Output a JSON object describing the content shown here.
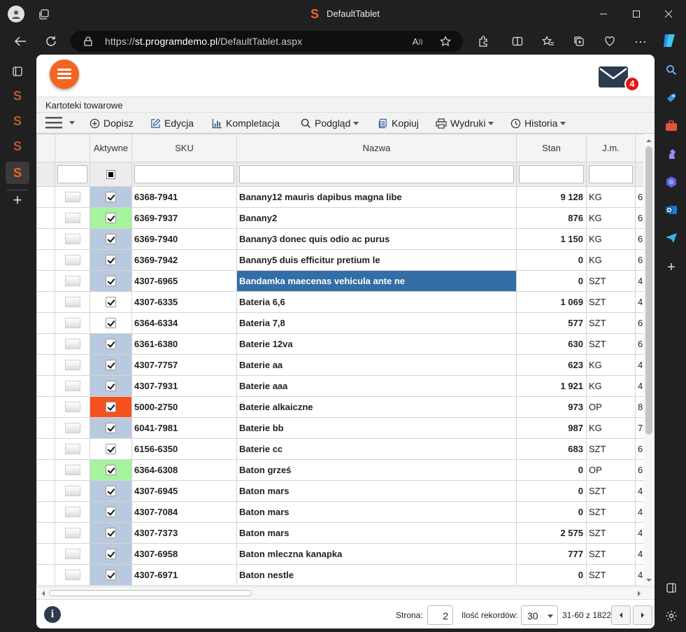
{
  "browser": {
    "title": "DefaultTablet",
    "url_scheme": "https://",
    "url_domain": "st.programdemo.pl",
    "url_path": "/DefaultTablet.aspx"
  },
  "page": {
    "breadcrumb": "Kartoteki towarowe",
    "mail_badge": "4",
    "toolbar": {
      "dopisz": "Dopisz",
      "edycja": "Edycja",
      "kompletacja": "Kompletacja",
      "podglad": "Podgląd",
      "kopiuj": "Kopiuj",
      "wydruki": "Wydruki",
      "historia": "Historia"
    },
    "columns": {
      "aktywne": "Aktywne",
      "sku": "SKU",
      "nazwa": "Nazwa",
      "stan": "Stan",
      "jm": "J.m."
    },
    "rows": [
      {
        "sku": "6368-7941",
        "name": "Banany12 mauris dapibus magna libe",
        "stan": "9 128",
        "jm": "KG",
        "x": "6",
        "status": "blue"
      },
      {
        "sku": "6369-7937",
        "name": "Banany2",
        "stan": "876",
        "jm": "KG",
        "x": "6",
        "status": "green"
      },
      {
        "sku": "6369-7940",
        "name": "Banany3 donec quis odio ac purus",
        "stan": "1 150",
        "jm": "KG",
        "x": "6",
        "status": "blue"
      },
      {
        "sku": "6369-7942",
        "name": "Banany5 duis efficitur pretium le",
        "stan": "0",
        "jm": "KG",
        "x": "6",
        "status": "blue"
      },
      {
        "sku": "4307-6965",
        "name": "Bandamka maecenas vehicula ante ne",
        "stan": "0",
        "jm": "SZT",
        "x": "4",
        "status": "blue",
        "selected": true
      },
      {
        "sku": "4307-6335",
        "name": "Bateria 6,6",
        "stan": "1 069",
        "jm": "SZT",
        "x": "4",
        "status": "none"
      },
      {
        "sku": "6364-6334",
        "name": "Bateria 7,8",
        "stan": "577",
        "jm": "SZT",
        "x": "6",
        "status": "none"
      },
      {
        "sku": "6361-6380",
        "name": "Baterie 12va",
        "stan": "630",
        "jm": "SZT",
        "x": "6",
        "status": "blue"
      },
      {
        "sku": "4307-7757",
        "name": "Baterie aa",
        "stan": "623",
        "jm": "KG",
        "x": "4",
        "status": "blue"
      },
      {
        "sku": "4307-7931",
        "name": "Baterie aaa",
        "stan": "1 921",
        "jm": "KG",
        "x": "4",
        "status": "blue"
      },
      {
        "sku": "5000-2750",
        "name": "Baterie alkaiczne",
        "stan": "973",
        "jm": "OP",
        "x": "8",
        "status": "orange"
      },
      {
        "sku": "6041-7981",
        "name": "Baterie bb",
        "stan": "987",
        "jm": "KG",
        "x": "7",
        "status": "blue"
      },
      {
        "sku": "6156-6350",
        "name": "Baterie cc",
        "stan": "683",
        "jm": "SZT",
        "x": "6",
        "status": "none"
      },
      {
        "sku": "6364-6308",
        "name": "Baton grześ",
        "stan": "0",
        "jm": "OP",
        "x": "6",
        "status": "green"
      },
      {
        "sku": "4307-6945",
        "name": "Baton mars",
        "stan": "0",
        "jm": "SZT",
        "x": "4",
        "status": "blue"
      },
      {
        "sku": "4307-7084",
        "name": "Baton mars",
        "stan": "0",
        "jm": "SZT",
        "x": "4",
        "status": "blue"
      },
      {
        "sku": "4307-7373",
        "name": "Baton mars",
        "stan": "2 575",
        "jm": "SZT",
        "x": "4",
        "status": "blue"
      },
      {
        "sku": "4307-6958",
        "name": "Baton mleczna kanapka",
        "stan": "777",
        "jm": "SZT",
        "x": "4",
        "status": "blue"
      },
      {
        "sku": "4307-6971",
        "name": "Baton nestle",
        "stan": "0",
        "jm": "SZT",
        "x": "4",
        "status": "blue"
      }
    ],
    "status_colors": {
      "blue": "#b9c9df",
      "green": "#a6f29e",
      "orange": "#f4511e",
      "none": "#ffffff"
    },
    "footer": {
      "page_label": "Strona:",
      "page_value": "2",
      "size_label": "Ilość rekordów:",
      "size_value": "30",
      "range": "31-60 z 1822"
    }
  }
}
